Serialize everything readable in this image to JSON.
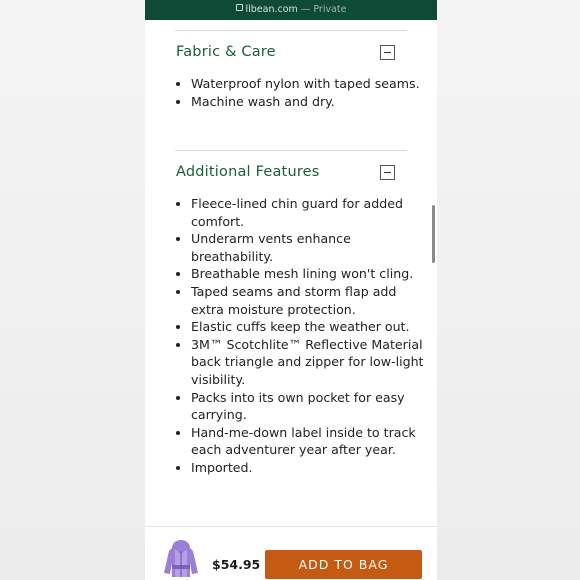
{
  "browser": {
    "domain": "llbean.com",
    "separator": "—",
    "mode": "Private"
  },
  "sections": [
    {
      "title": "Fabric & Care",
      "toggle_icon": "minus-icon",
      "items": [
        "Waterproof nylon with taped seams.",
        "Machine wash and dry."
      ]
    },
    {
      "title": "Additional Features",
      "toggle_icon": "minus-icon",
      "items": [
        "Fleece-lined chin guard for added comfort.",
        "Underarm vents enhance breathability.",
        "Breathable mesh lining won't cling.",
        "Taped seams and storm flap add extra moisture protection.",
        "Elastic cuffs keep the weather out.",
        "3M™ Scotchlite™ Reflective Material back triangle and zipper for low-light visibility.",
        "Packs into its own pocket for easy carrying.",
        "Hand-me-down label inside to track each adventurer year after year.",
        "Imported."
      ]
    }
  ],
  "cart_bar": {
    "price": "$54.95",
    "add_button_label": "ADD TO BAG",
    "button_color": "#c75a12",
    "thumbnail_icon": "purple-jacket-thumbnail"
  },
  "colors": {
    "brand_green": "#0f4a36",
    "heading_green": "#1b5e3a"
  }
}
